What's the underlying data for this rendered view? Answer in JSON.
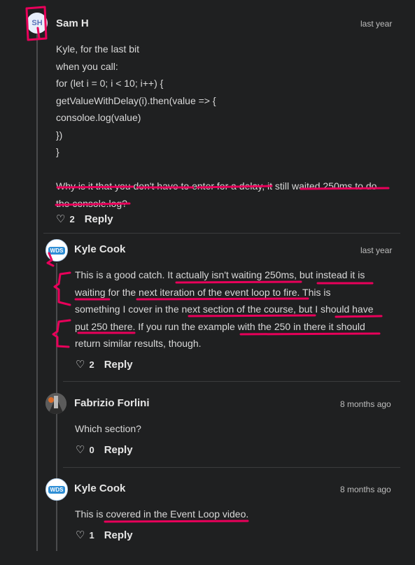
{
  "comments": [
    {
      "avatar_initials": "SH",
      "author": "Sam H",
      "time": "last year",
      "lines": [
        "Kyle, for the last bit",
        "when you call:",
        "for (let i = 0; i < 10; i++) {",
        "getValueWithDelay(i).then(value => {",
        "consoloe.log(value)",
        "})",
        "}",
        "",
        "Why is it that you don't have to enter for a delay, it still waited 250ms to do",
        "the console.log?"
      ],
      "likes": "2",
      "reply_label": "Reply"
    },
    {
      "avatar_label": "WDS",
      "author": "Kyle Cook",
      "time": "last year",
      "lines": [
        "This is a good catch. It actually isn't waiting 250ms, but instead it is",
        "waiting for the next iteration of the event loop to fire. This is",
        "something I cover in the next section of the course, but I should have",
        "put 250 there. If you run the example with the 250 in there it should",
        "return similar results, though."
      ],
      "likes": "2",
      "reply_label": "Reply"
    },
    {
      "author": "Fabrizio Forlini",
      "time": "8 months ago",
      "lines": [
        "Which section?"
      ],
      "likes": "0",
      "reply_label": "Reply"
    },
    {
      "avatar_label": "WDS",
      "author": "Kyle Cook",
      "time": "8 months ago",
      "lines": [
        "This is covered in the Event Loop video."
      ],
      "likes": "1",
      "reply_label": "Reply"
    }
  ],
  "colors": {
    "background": "#1f2021",
    "annotation": "#e8005a",
    "text": "#d9d9d9"
  }
}
